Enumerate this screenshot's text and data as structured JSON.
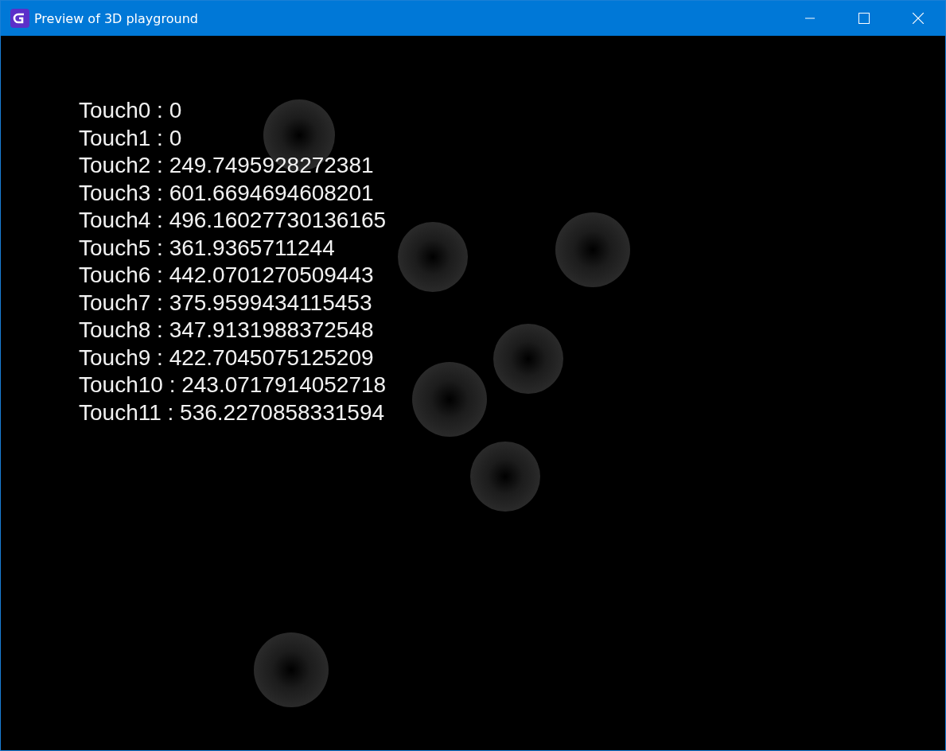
{
  "window": {
    "title": "Preview of 3D playground"
  },
  "touches": [
    {
      "label": "Touch0 : 0"
    },
    {
      "label": "Touch1 : 0"
    },
    {
      "label": "Touch2 : 249.7495928272381"
    },
    {
      "label": "Touch3 : 601.6694694608201"
    },
    {
      "label": "Touch4 : 496.16027730136165"
    },
    {
      "label": "Touch5 : 361.9365711244"
    },
    {
      "label": "Touch6 : 442.0701270509443"
    },
    {
      "label": "Touch7 : 375.9599434115453"
    },
    {
      "label": "Touch8 : 347.9131988372548"
    },
    {
      "label": "Touch9 : 422.7045075125209"
    },
    {
      "label": "Touch10 : 243.0717914052718"
    },
    {
      "label": "Touch11 : 536.2270858331594"
    }
  ]
}
